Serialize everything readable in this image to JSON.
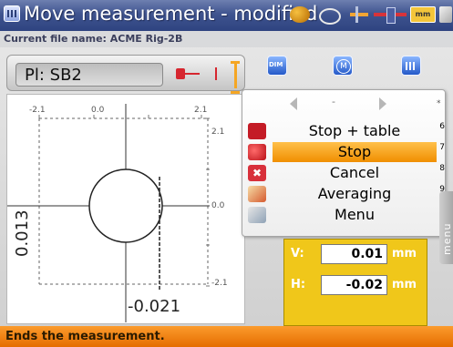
{
  "window": {
    "title": "Move measurement - modified",
    "unit_badge": "mm",
    "status_icons": [
      "motor-icon",
      "laser-icon",
      "plug-icon",
      "coupling-icon",
      "unit-icon",
      "tool-icon"
    ]
  },
  "file": {
    "label": "Current file name: ACME Rig-2B"
  },
  "plane": {
    "label": "Pl: SB2"
  },
  "plot": {
    "top_ticks": [
      "-2.1",
      "0.0",
      "2.1"
    ],
    "right_ticks": [
      "2.1",
      "0.0",
      "-2.1"
    ],
    "vertical_value": "0.013",
    "horizontal_value": "-0.021"
  },
  "softkeys": [
    {
      "name": "dim-softkey",
      "icon": "dim-icon"
    },
    {
      "name": "measure-softkey",
      "icon": "m-icon"
    },
    {
      "name": "grid-softkey",
      "icon": "grid-icon"
    }
  ],
  "menu": {
    "nav_dash": "-",
    "star": "*",
    "items": [
      {
        "label": "Stop + table",
        "key": "6",
        "selected": false
      },
      {
        "label": "Stop",
        "key": "7",
        "selected": true
      },
      {
        "label": "Cancel",
        "key": "8",
        "selected": false
      },
      {
        "label": "Averaging",
        "key": "9",
        "selected": false
      },
      {
        "label": "Menu",
        "key": "0",
        "selected": false
      }
    ],
    "side_tab": "menu"
  },
  "readout": {
    "v_label": "V:",
    "v_value": "0.01",
    "h_label": "H:",
    "h_value": "-0.02",
    "unit": "mm"
  },
  "status": {
    "text": "Ends the measurement."
  },
  "colors": {
    "title_bar": "#3f548f",
    "selected_item": "#f08e00",
    "readout_bg": "#f0c71a",
    "status_bar": "#f08a1a",
    "accent_red": "#d6262f"
  }
}
